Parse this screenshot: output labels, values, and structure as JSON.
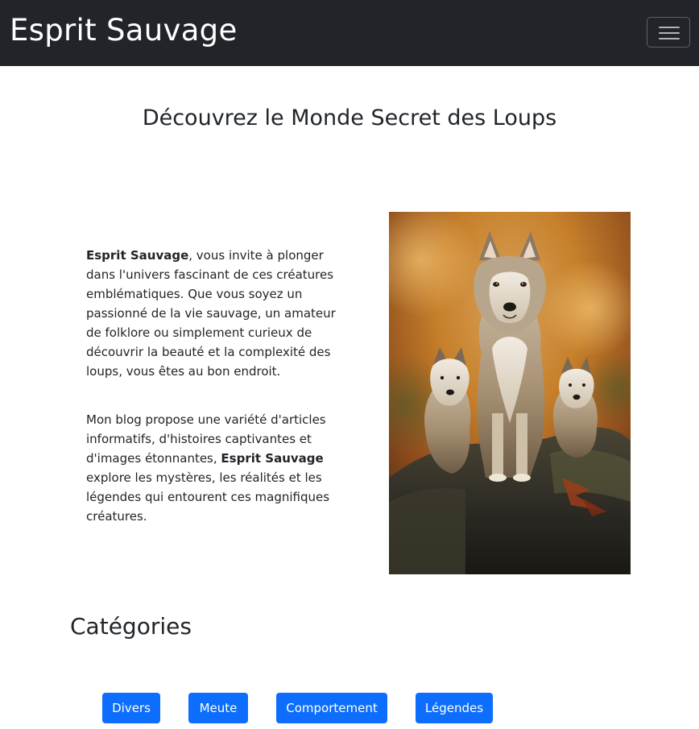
{
  "navbar": {
    "brand": "Esprit Sauvage",
    "toggle_icon": "hamburger-menu-icon"
  },
  "hero": {
    "title": "Découvrez le Monde Secret des Loups"
  },
  "intro": {
    "p1_bold": "Esprit Sauvage",
    "p1_text": ", vous invite à plonger dans l'univers fascinant de ces créatures emblématiques. Que vous soyez un passionné de la vie sauvage, un amateur de folklore ou simplement curieux de découvrir la beauté et la complexité des loups, vous êtes au bon endroit.",
    "p2_text_before": "Mon blog propose une variété d'articles informatifs, d'histoires captivantes et d'images étonnantes, ",
    "p2_bold": "Esprit Sauvage",
    "p2_text_after": " explore les mystères, les réalités et les légendes qui entourent ces magnifiques créatures."
  },
  "image": {
    "subject": "three-wolves-on-rock-photo"
  },
  "categories": {
    "title": "Catégories",
    "buttons": [
      "Divers",
      "Meute",
      "Comportement",
      "Légendes"
    ]
  },
  "colors": {
    "navbar_bg": "#212529",
    "button_primary": "#0d6efd"
  }
}
